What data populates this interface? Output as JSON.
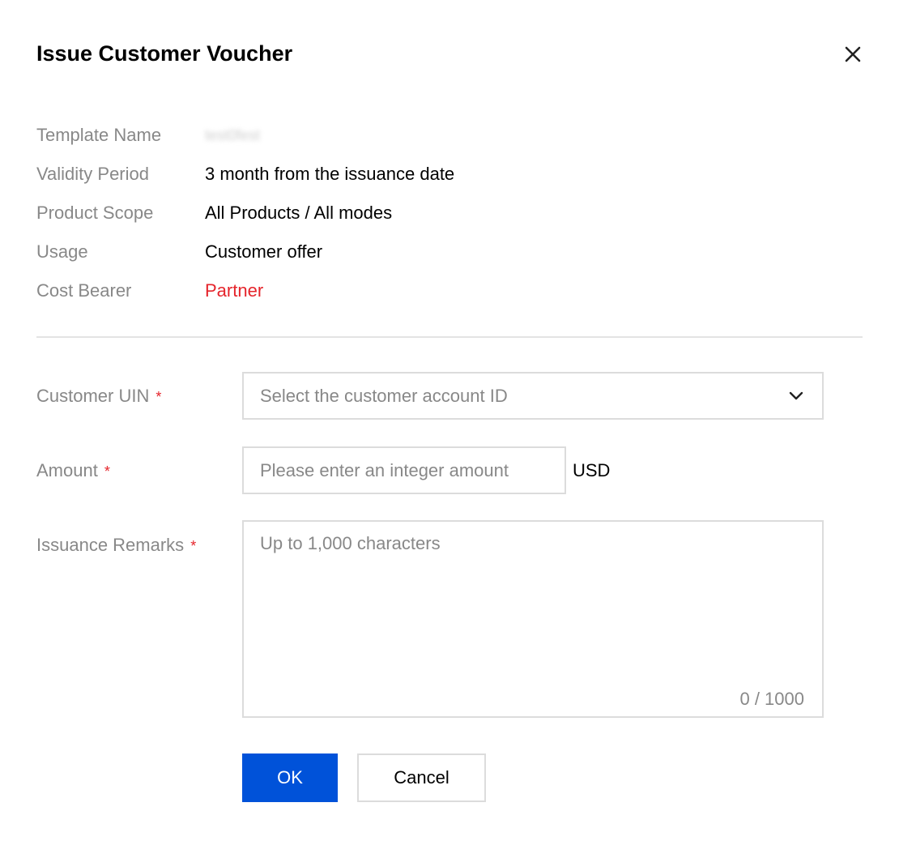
{
  "dialog": {
    "title": "Issue Customer Voucher",
    "close_icon": "close-icon"
  },
  "details": [
    {
      "label": "Template Name",
      "value": "test0fest"
    },
    {
      "label": "Validity Period",
      "value": "3 month from the issuance date"
    },
    {
      "label": "Product Scope",
      "value": "All Products / All modes"
    },
    {
      "label": "Usage",
      "value": "Customer offer"
    },
    {
      "label": "Cost Bearer",
      "value": "Partner"
    }
  ],
  "form": {
    "customer_uin": {
      "label": "Customer UIN",
      "required_mark": "*",
      "placeholder": "Select the customer account ID",
      "icon": "chevron-down-icon"
    },
    "amount": {
      "label": "Amount",
      "required_mark": "*",
      "placeholder": "Please enter an integer amount",
      "value": "",
      "unit": "USD"
    },
    "remarks": {
      "label": "Issuance Remarks",
      "required_mark": "*",
      "placeholder": "Up to 1,000 characters",
      "value": "",
      "counter": "0 / 1000"
    }
  },
  "actions": {
    "ok_label": "OK",
    "cancel_label": "Cancel"
  },
  "colors": {
    "primary": "#0052d9",
    "required": "#e5242b",
    "cost_bearer_value": "#e5242b",
    "muted_text": "#888888",
    "border": "#dcdcdc"
  }
}
